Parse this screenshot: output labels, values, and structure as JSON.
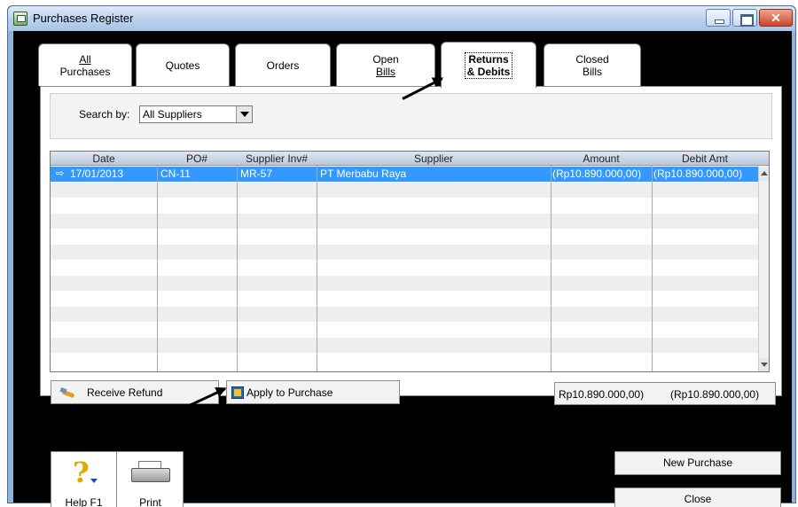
{
  "window": {
    "title": "Purchases Register"
  },
  "tabs": [
    {
      "line1": "All",
      "line2": "Purchases"
    },
    {
      "line1": "Quotes",
      "line2": ""
    },
    {
      "line1": "Orders",
      "line2": ""
    },
    {
      "line1": "Open",
      "line2": "Bills"
    },
    {
      "line1": "Returns",
      "line2": "& Debits"
    },
    {
      "line1": "Closed",
      "line2": "Bills"
    }
  ],
  "active_tab_index": 4,
  "search": {
    "label": "Search by:",
    "value": "All Suppliers"
  },
  "table": {
    "columns": [
      "Date",
      "PO#",
      "Supplier Inv#",
      "Supplier",
      "Amount",
      "Debit Amt"
    ],
    "rows": [
      [
        "17/01/2013",
        "CN-11",
        "MR-57",
        "PT Merbabu Raya",
        "(Rp10.890.000,00)",
        "(Rp10.890.000,00)"
      ]
    ],
    "empty_rows": 12
  },
  "actions": {
    "receive_refund": "Receive Refund",
    "apply_to_purchase": "Apply to Purchase"
  },
  "totals": {
    "amount": "Rp10.890.000,00)",
    "debit": "(Rp10.890.000,00)"
  },
  "tools": {
    "help": "Help F1",
    "print": "Print"
  },
  "buttons": {
    "new_purchase": "New Purchase",
    "close": "Close"
  }
}
